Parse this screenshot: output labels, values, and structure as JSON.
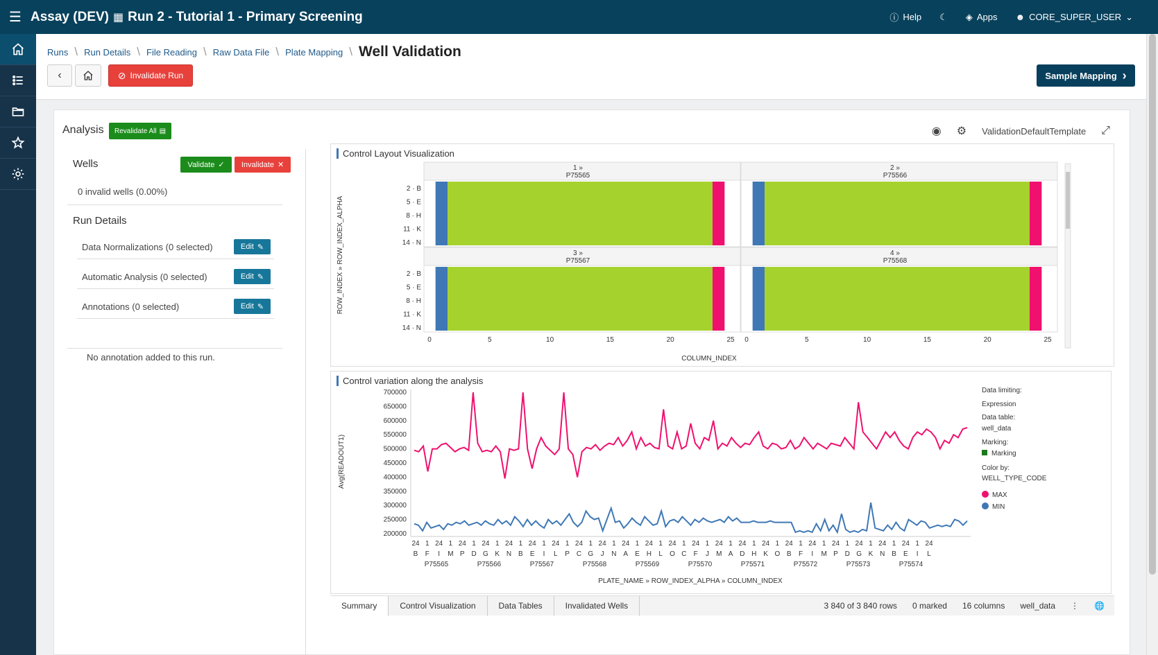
{
  "topbar": {
    "app": "Assay (DEV)",
    "title": "Run 2 - Tutorial 1 - Primary Screening",
    "help": "Help",
    "apps": "Apps",
    "user": "CORE_SUPER_USER"
  },
  "breadcrumb": {
    "items": [
      "Runs",
      "Run Details",
      "File Reading",
      "Raw Data File",
      "Plate Mapping"
    ],
    "current": "Well Validation"
  },
  "header": {
    "invalidate_run": "Invalidate Run",
    "sample_mapping": "Sample Mapping"
  },
  "analysis": {
    "title": "Analysis",
    "revalidate_all": "Revalidate All",
    "template": "ValidationDefaultTemplate"
  },
  "wells": {
    "title": "Wells",
    "validate": "Validate",
    "invalidate": "Invalidate",
    "invalid_count": "0 invalid wells (0.00%)"
  },
  "run_details": {
    "title": "Run Details",
    "rows": [
      {
        "label": "Data Normalizations (0 selected)",
        "button": "Edit"
      },
      {
        "label": "Automatic Analysis (0 selected)",
        "button": "Edit"
      },
      {
        "label": "Annotations (0 selected)",
        "button": "Edit"
      }
    ],
    "no_annotation": "No annotation added to this run."
  },
  "colors": {
    "min": "#3f78b5",
    "sample": "#a6d22e",
    "max": "#f0106e",
    "marking": "#1b7a1b"
  },
  "chart_data": [
    {
      "type": "heatmap",
      "title": "Control Layout Visualization",
      "xlabel": "COLUMN_INDEX",
      "ylabel": "ROW_INDEX » ROW_INDEX_ALPHA",
      "xlim": [
        0,
        25
      ],
      "x_ticks": [
        "0",
        "5",
        "10",
        "15",
        "20",
        "25"
      ],
      "y_ticks": [
        "2 · B",
        "5 · E",
        "8 · H",
        "11 · K",
        "14 · N"
      ],
      "panels": [
        {
          "index": "1 »",
          "plate": "P75565"
        },
        {
          "index": "2 »",
          "plate": "P75566"
        },
        {
          "index": "3 »",
          "plate": "P75567"
        },
        {
          "index": "4 »",
          "plate": "P75568"
        }
      ],
      "bands": [
        {
          "type": "MIN",
          "from": 0.5,
          "to": 1.5
        },
        {
          "type": "SAMPLE",
          "from": 1.5,
          "to": 23.5
        },
        {
          "type": "MAX",
          "from": 23.5,
          "to": 24.5
        }
      ]
    },
    {
      "type": "line",
      "title": "Control variation along the analysis",
      "xlabel": "PLATE_NAME » ROW_INDEX_ALPHA » COLUMN_INDEX",
      "ylabel": "Avg(READOUT1)",
      "ylim": [
        190000,
        710000
      ],
      "y_ticks": [
        200000,
        250000,
        300000,
        350000,
        400000,
        450000,
        500000,
        550000,
        600000,
        650000,
        700000
      ],
      "plates": [
        "P75565",
        "P75566",
        "P75567",
        "P75568",
        "P75569",
        "P75570",
        "P75571",
        "P75572",
        "P75573",
        "P75574"
      ],
      "row_letters": [
        "B",
        "F",
        "I",
        "M",
        "P",
        "D",
        "G",
        "K",
        "N",
        "B",
        "E",
        "I",
        "L",
        "P",
        "C",
        "G",
        "J",
        "N",
        "A",
        "E",
        "H",
        "L",
        "O",
        "C",
        "F",
        "J",
        "M",
        "A",
        "D",
        "H",
        "K",
        "O",
        "B",
        "F",
        "I",
        "M",
        "P",
        "D",
        "G",
        "K",
        "N",
        "B",
        "E",
        "I",
        "L"
      ],
      "col_ticks": [
        "24",
        "1",
        "24",
        "1",
        "24",
        "1",
        "24",
        "1",
        "24",
        "1",
        "24",
        "1",
        "24",
        "1",
        "24",
        "1",
        "24",
        "1",
        "24",
        "1",
        "24",
        "1",
        "24",
        "1",
        "24",
        "1",
        "24",
        "1",
        "24",
        "1",
        "24",
        "1",
        "24",
        "1",
        "24",
        "1",
        "24",
        "1",
        "24",
        "1",
        "24",
        "1",
        "24",
        "1",
        "24"
      ],
      "series": [
        {
          "name": "MAX",
          "values": [
            495000,
            490000,
            510000,
            420000,
            500000,
            500000,
            515000,
            520000,
            505000,
            490000,
            500000,
            505000,
            495000,
            700000,
            520000,
            490000,
            495000,
            490000,
            510000,
            490000,
            395000,
            500000,
            495000,
            500000,
            700000,
            500000,
            430000,
            500000,
            540000,
            510000,
            495000,
            480000,
            500000,
            700000,
            500000,
            480000,
            400000,
            490000,
            505000,
            500000,
            515000,
            495000,
            510000,
            520000,
            515000,
            540000,
            510000,
            530000,
            560000,
            500000,
            540000,
            510000,
            520000,
            505000,
            500000,
            640000,
            510000,
            500000,
            560000,
            500000,
            510000,
            590000,
            520000,
            500000,
            540000,
            530000,
            600000,
            500000,
            520000,
            510000,
            540000,
            520000,
            505000,
            520000,
            515000,
            540000,
            560000,
            510000,
            500000,
            520000,
            515000,
            500000,
            505000,
            530000,
            500000,
            510000,
            540000,
            520000,
            500000,
            520000,
            510000,
            500000,
            520000,
            515000,
            510000,
            540000,
            520000,
            500000,
            665000,
            560000,
            540000,
            520000,
            500000,
            530000,
            560000,
            540000,
            560000,
            530000,
            510000,
            500000,
            540000,
            560000,
            550000,
            570000,
            560000,
            540000,
            500000,
            530000,
            520000,
            550000,
            540000,
            570000,
            575000
          ]
        },
        {
          "name": "MIN",
          "values": [
            235000,
            230000,
            210000,
            240000,
            220000,
            225000,
            230000,
            215000,
            235000,
            230000,
            240000,
            235000,
            245000,
            230000,
            235000,
            240000,
            230000,
            245000,
            235000,
            230000,
            250000,
            235000,
            245000,
            230000,
            260000,
            245000,
            225000,
            250000,
            230000,
            245000,
            230000,
            220000,
            250000,
            235000,
            245000,
            230000,
            250000,
            270000,
            240000,
            225000,
            240000,
            280000,
            260000,
            250000,
            255000,
            210000,
            250000,
            290000,
            240000,
            245000,
            220000,
            235000,
            255000,
            240000,
            230000,
            260000,
            245000,
            230000,
            235000,
            280000,
            225000,
            245000,
            250000,
            240000,
            260000,
            245000,
            230000,
            250000,
            240000,
            255000,
            245000,
            240000,
            245000,
            250000,
            240000,
            260000,
            245000,
            255000,
            240000,
            240000,
            240000,
            245000,
            240000,
            240000,
            240000,
            245000,
            240000,
            240000,
            240000,
            240000,
            240000,
            205000,
            210000,
            205000,
            210000,
            205000,
            235000,
            210000,
            250000,
            210000,
            230000,
            205000,
            270000,
            215000,
            205000,
            210000,
            205000,
            215000,
            210000,
            310000,
            220000,
            215000,
            210000,
            230000,
            215000,
            240000,
            220000,
            210000,
            250000,
            240000,
            230000,
            245000,
            240000,
            220000,
            225000,
            230000,
            225000,
            230000,
            225000,
            250000,
            245000,
            230000,
            245000
          ]
        }
      ],
      "legend": {
        "data_limiting_label": "Data limiting:",
        "data_limiting_value": "Expression",
        "data_table_label": "Data table:",
        "data_table_value": "well_data",
        "marking_label": "Marking:",
        "marking_value": "Marking",
        "color_by_label": "Color by:",
        "color_by_value": "WELL_TYPE_CODE",
        "items": [
          "MAX",
          "MIN"
        ]
      }
    }
  ],
  "bottombar": {
    "tabs": [
      "Summary",
      "Control Visualization",
      "Data Tables",
      "Invalidated Wells"
    ],
    "rows": "3 840 of 3 840 rows",
    "marked": "0 marked",
    "columns": "16 columns",
    "table": "well_data"
  }
}
